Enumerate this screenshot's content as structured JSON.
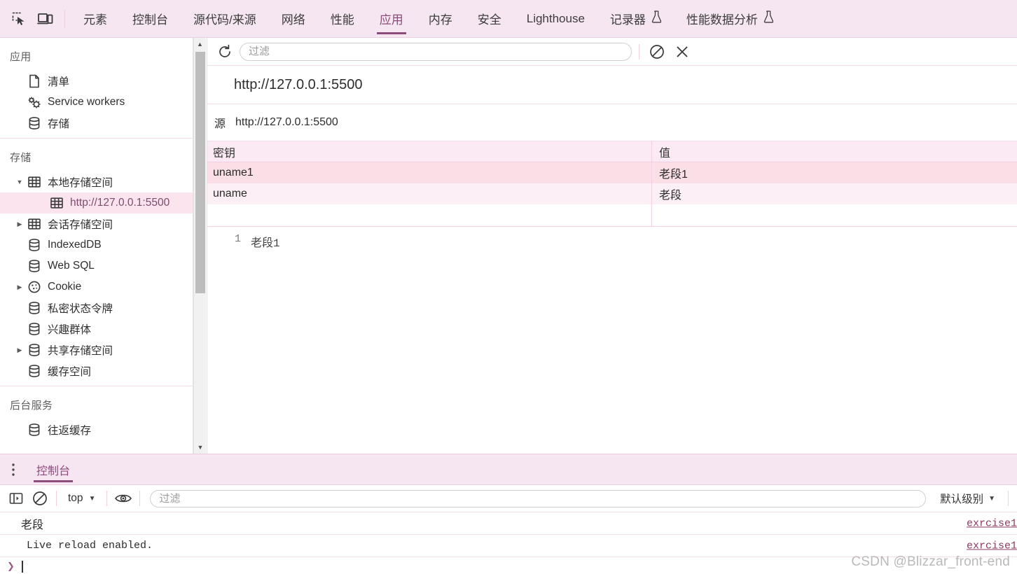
{
  "toolbar": {
    "inspect_icon": "inspect-element-icon",
    "device_icon": "device-toolbar-icon"
  },
  "tabs": [
    {
      "label": "元素",
      "active": false,
      "experimental": false
    },
    {
      "label": "控制台",
      "active": false,
      "experimental": false
    },
    {
      "label": "源代码/来源",
      "active": false,
      "experimental": false
    },
    {
      "label": "网络",
      "active": false,
      "experimental": false
    },
    {
      "label": "性能",
      "active": false,
      "experimental": false
    },
    {
      "label": "应用",
      "active": true,
      "experimental": false
    },
    {
      "label": "内存",
      "active": false,
      "experimental": false
    },
    {
      "label": "安全",
      "active": false,
      "experimental": false
    },
    {
      "label": "Lighthouse",
      "active": false,
      "experimental": false
    },
    {
      "label": "记录器",
      "active": false,
      "experimental": true
    },
    {
      "label": "性能数据分析",
      "active": false,
      "experimental": true
    }
  ],
  "sidebar": {
    "sections": [
      {
        "title": "应用",
        "items": [
          {
            "label": "清单",
            "icon": "manifest-file-icon",
            "arrow": "none",
            "indent": 1,
            "selected": false
          },
          {
            "label": "Service workers",
            "icon": "gears-icon",
            "arrow": "none",
            "indent": 1,
            "selected": false
          },
          {
            "label": "存储",
            "icon": "database-icon",
            "arrow": "none",
            "indent": 1,
            "selected": false
          }
        ]
      },
      {
        "title": "存储",
        "items": [
          {
            "label": "本地存储空间",
            "icon": "table-grid-icon",
            "arrow": "expanded",
            "indent": 1,
            "selected": false
          },
          {
            "label": "http://127.0.0.1:5500",
            "icon": "table-grid-icon",
            "arrow": "none",
            "indent": 2,
            "selected": true
          },
          {
            "label": "会话存储空间",
            "icon": "table-grid-icon",
            "arrow": "collapsed",
            "indent": 1,
            "selected": false
          },
          {
            "label": "IndexedDB",
            "icon": "database-icon",
            "arrow": "none",
            "indent": 1,
            "selected": false
          },
          {
            "label": "Web SQL",
            "icon": "database-icon",
            "arrow": "none",
            "indent": 1,
            "selected": false
          },
          {
            "label": "Cookie",
            "icon": "cookie-icon",
            "arrow": "collapsed",
            "indent": 1,
            "selected": false
          },
          {
            "label": "私密状态令牌",
            "icon": "database-icon",
            "arrow": "none",
            "indent": 1,
            "selected": false
          },
          {
            "label": "兴趣群体",
            "icon": "database-icon",
            "arrow": "none",
            "indent": 1,
            "selected": false
          },
          {
            "label": "共享存储空间",
            "icon": "database-icon",
            "arrow": "collapsed",
            "indent": 1,
            "selected": false
          },
          {
            "label": "缓存空间",
            "icon": "database-icon",
            "arrow": "none",
            "indent": 1,
            "selected": false
          }
        ]
      },
      {
        "title": "后台服务",
        "items": [
          {
            "label": "往返缓存",
            "icon": "database-icon",
            "arrow": "none",
            "indent": 1,
            "selected": false
          }
        ]
      }
    ]
  },
  "main": {
    "toolbar": {
      "refresh_icon": "refresh-icon",
      "filter_placeholder": "过滤",
      "filter_value": "",
      "clear_icon": "clear-circle-slash-icon",
      "delete_icon": "delete-x-icon"
    },
    "origin_title": "http://127.0.0.1:5500",
    "origin_label": "源",
    "origin_value": "http://127.0.0.1:5500",
    "table": {
      "columns": [
        "密钥",
        "值"
      ],
      "rows": [
        {
          "key": "uname1",
          "value": "老段1",
          "selected": true
        },
        {
          "key": "uname",
          "value": "老段",
          "selected": false
        }
      ]
    },
    "preview": {
      "line_number": "1",
      "value": "老段1"
    }
  },
  "drawer": {
    "menu_icon": "kebab-menu-icon",
    "tab_label": "控制台",
    "toolbar": {
      "sidebar_icon": "show-console-sidebar-icon",
      "clear_icon": "clear-console-icon",
      "context": "top",
      "eye_icon": "live-expression-eye-icon",
      "filter_placeholder": "过滤",
      "filter_value": "",
      "levels_label": "默认级别"
    },
    "messages": [
      {
        "text": "老段",
        "source": "exrcise1",
        "mono": false
      },
      {
        "text": "Live reload enabled.",
        "source": "exrcise1",
        "mono": true
      }
    ]
  },
  "watermark": "CSDN @Blizzar_front-end",
  "colors": {
    "accent": "#8d4b7c",
    "toolbar_bg": "#f6e6f1",
    "selected_row": "#fadfe7",
    "alt_row": "#fcf0f6",
    "link": "#8b3a62"
  }
}
